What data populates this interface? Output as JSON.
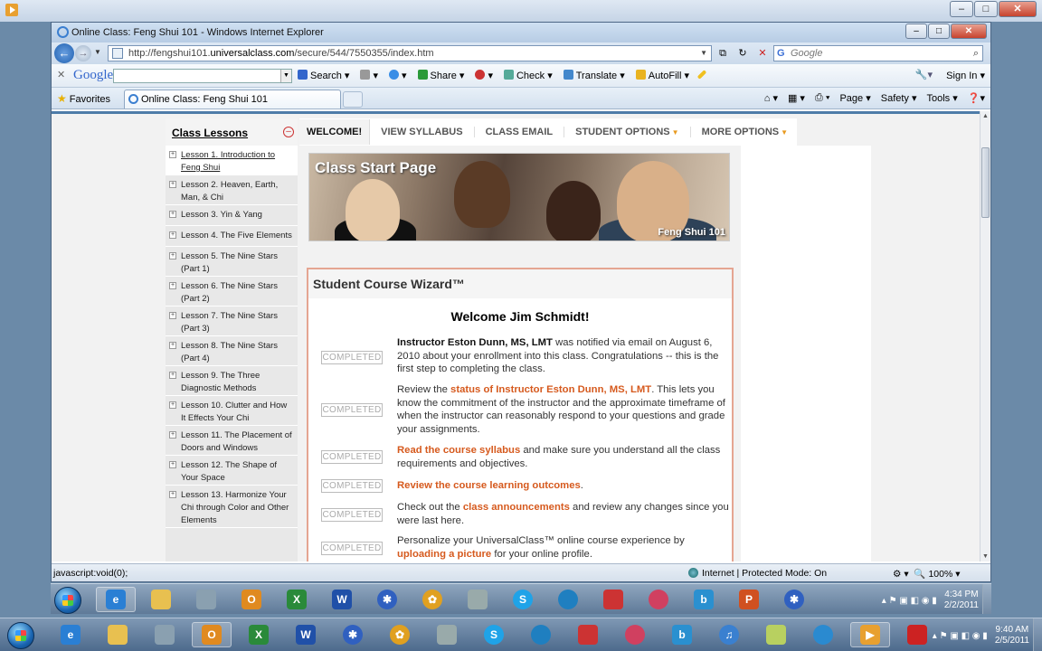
{
  "window": {
    "title": "Online Class: Feng Shui 101 - Windows Internet Explorer",
    "url_prefix": "http://fengshui101.",
    "url_domain": "universalclass.com",
    "url_suffix": "/secure/544/7550355/index.htm",
    "search_placeholder": "Google"
  },
  "google_bar": {
    "logo": "Google",
    "items": [
      "Search ▾",
      "▾",
      "▾",
      "Share ▾",
      "▾",
      "Check ▾",
      "Translate ▾",
      "AutoFill ▾"
    ],
    "sign_in": "Sign In ▾"
  },
  "favorites": {
    "label": "Favorites",
    "tab_title": "Online Class: Feng Shui 101",
    "commands": [
      "▾",
      "Page ▾",
      "Safety ▾",
      "Tools ▾",
      "▾"
    ]
  },
  "sidebar": {
    "title": "Class Lessons",
    "lessons": [
      "Lesson 1. Introduction to Feng Shui",
      "Lesson 2. Heaven, Earth, Man, & Chi",
      "Lesson 3. Yin & Yang",
      "Lesson 4. The Five Elements",
      "Lesson 5. The Nine Stars (Part 1)",
      "Lesson 6. The Nine Stars (Part 2)",
      "Lesson 7. The Nine Stars (Part 3)",
      "Lesson 8. The Nine Stars (Part 4)",
      "Lesson 9. The Three Diagnostic Methods",
      "Lesson 10. Clutter and How It Effects Your Chi",
      "Lesson 11. The Placement of Doors and Windows",
      "Lesson 12. The Shape of Your Space",
      "Lesson 13. Harmonize Your Chi through Color and Other Elements"
    ]
  },
  "tabs": [
    "WELCOME!",
    "VIEW SYLLABUS",
    "CLASS EMAIL",
    "STUDENT OPTIONS",
    "MORE OPTIONS"
  ],
  "banner": {
    "title": "Class Start Page",
    "course": "Feng Shui 101"
  },
  "wizard": {
    "title": "Student Course Wizard™",
    "welcome": "Welcome Jim Schmidt!",
    "badge": "COMPLETED",
    "rows": [
      {
        "b": "Instructor Eston Dunn, MS, LMT",
        "t": " was notified via email on August 6, 2010 about your enrollment into this class. Congratulations -- this is the first step to completing the class."
      },
      {
        "pre": "Review the ",
        "o": "status of Instructor Eston Dunn, MS, LMT",
        "t": ". This lets you know the commitment of the instructor and the approximate timeframe of when the instructor can reasonably respond to your questions and grade your assignments."
      },
      {
        "o": "Read the course syllabus",
        "t": " and make sure you understand all the class requirements and objectives."
      },
      {
        "o": "Review the course learning outcomes",
        "t": "."
      },
      {
        "pre": "Check out the ",
        "o": "class announcements",
        "t": " and review any changes since you were last here."
      },
      {
        "pre": "Personalize your UniversalClass™ online course experience by ",
        "o": "uploading a picture",
        "t": " for your online profile."
      }
    ]
  },
  "status": {
    "left": "javascript:void(0);",
    "zone": "Internet | Protected Mode: On",
    "zoom": "100%"
  },
  "taskbar_inner": {
    "time": "4:34 PM",
    "date": "2/2/2011"
  },
  "taskbar_outer": {
    "time": "9:40 AM",
    "date": "2/5/2011"
  }
}
